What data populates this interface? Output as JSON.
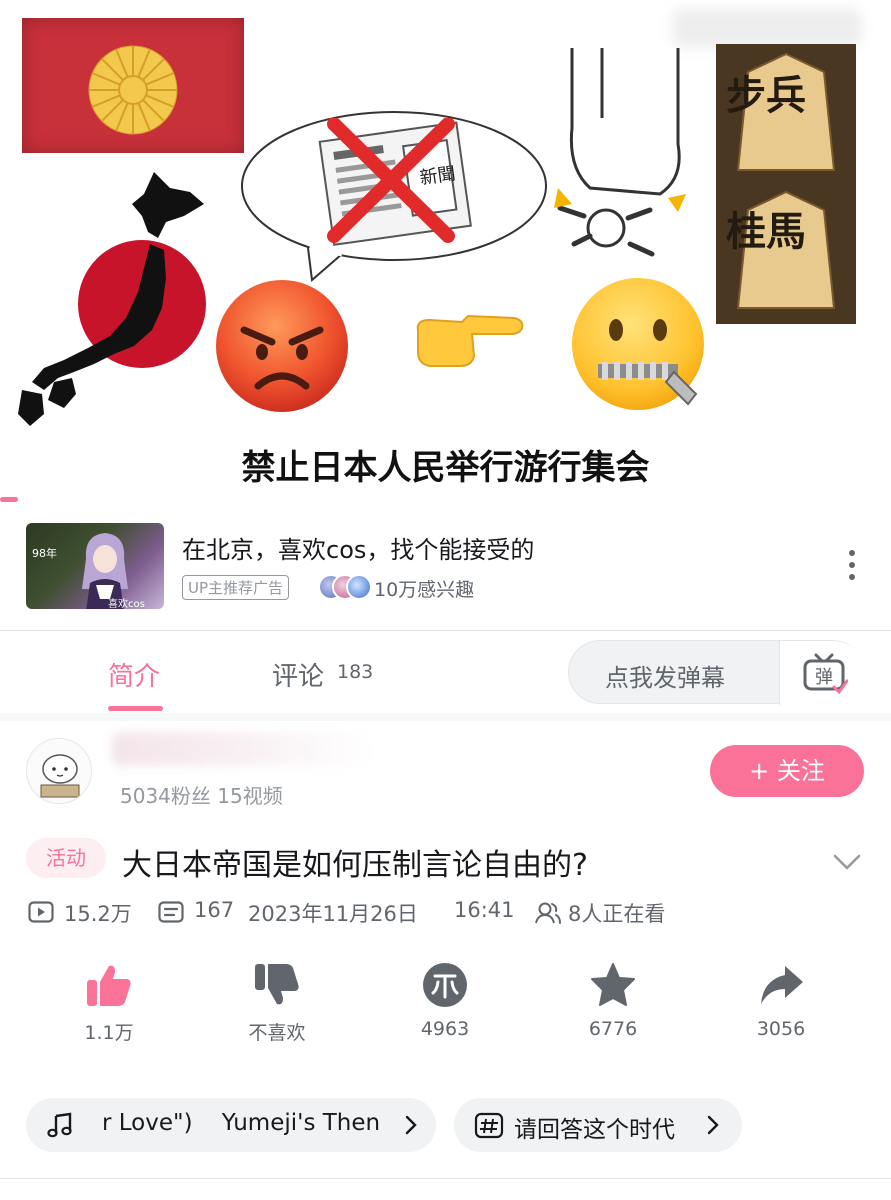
{
  "video": {
    "caption": "禁止日本人民举行游行集会",
    "shogi": {
      "top": "步兵",
      "bottom": "桂馬"
    },
    "newspaper_text": "新聞"
  },
  "ad": {
    "thumb_label": "98年",
    "thumb_sub": "喜欢cos",
    "title": "在北京，喜欢cos，找个能接受的",
    "tag": "UP主推荐广告",
    "interest": "10万感兴趣"
  },
  "tabs": {
    "intro": "简介",
    "comment": "评论",
    "comment_count": "183"
  },
  "danmaku": {
    "placeholder": "点我发弹幕",
    "icon_glyph": "弹"
  },
  "uploader": {
    "stats": "5034粉丝  15视频",
    "follow_label": "+ 关注"
  },
  "title": {
    "activity_tag": "活动",
    "text": "大日本帝国是如何压制言论自由的?"
  },
  "meta": {
    "views": "15.2万",
    "danmaku_count": "167",
    "date": "2023年11月26日",
    "time": "16:41",
    "watching": "8人正在看"
  },
  "actions": {
    "like": "1.1万",
    "dislike": "不喜欢",
    "coin": "4963",
    "favorite": "6776",
    "share": "3056"
  },
  "chips": {
    "music": "r Love\")    Yumeji's Then",
    "topic": "请回答这个时代"
  },
  "colors": {
    "accent": "#fb7299",
    "text_primary": "#18191c",
    "text_secondary": "#61666d",
    "text_muted": "#9499a0"
  }
}
